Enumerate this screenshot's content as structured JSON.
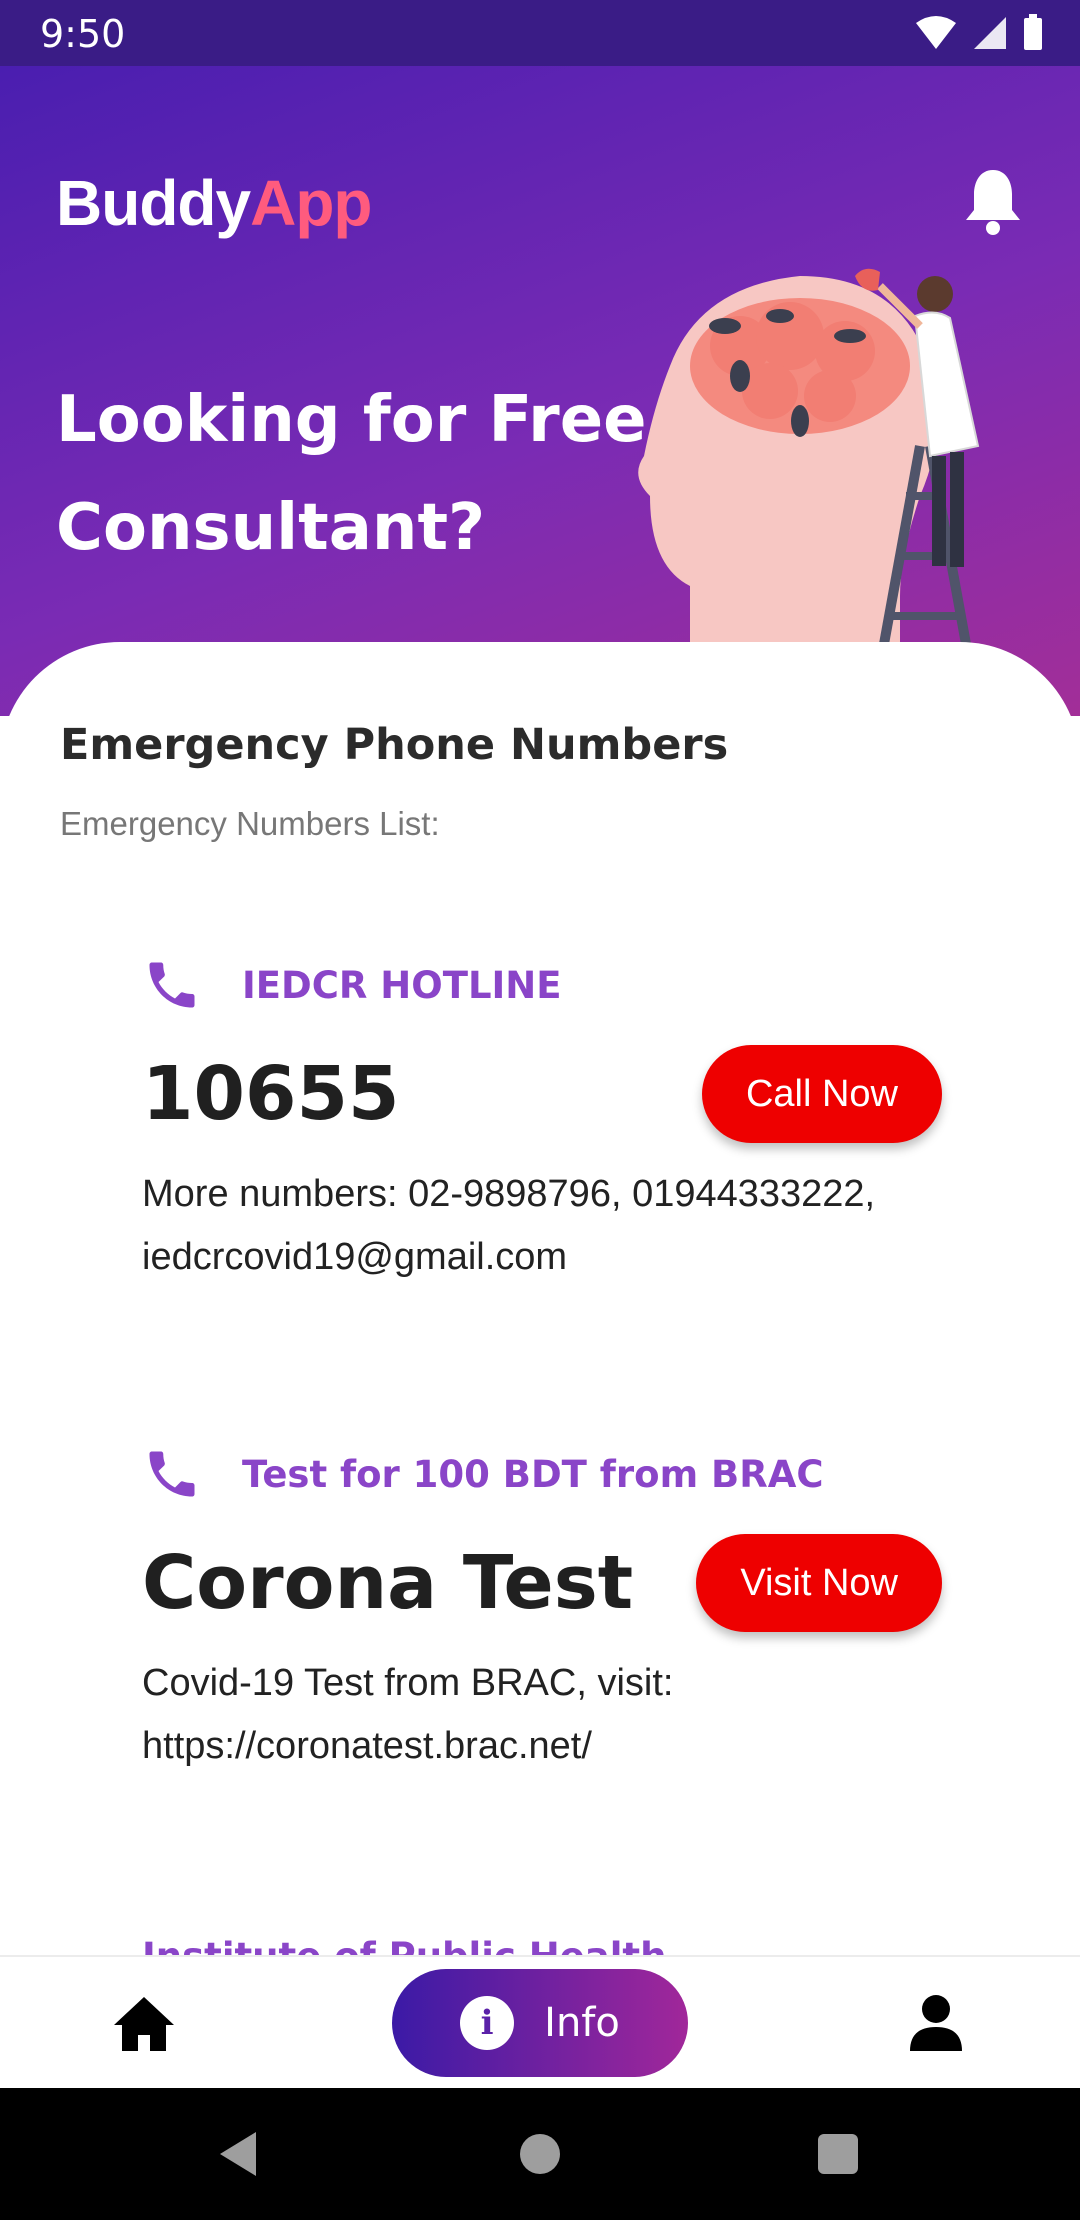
{
  "status_bar": {
    "time": "9:50"
  },
  "header": {
    "logo_part1": "Buddy",
    "logo_part2": "App",
    "title_line1": "Looking for Free",
    "title_line2": "Consultant?"
  },
  "section": {
    "title": "Emergency Phone Numbers",
    "subtitle": "Emergency Numbers List:"
  },
  "cards": [
    {
      "tag": "IEDCR HOTLINE",
      "main": "10655",
      "button": "Call Now",
      "desc": "More numbers: 02-9898796, 01944333222, iedcrcovid19@gmail.com"
    },
    {
      "tag": "Test for 100 BDT from BRAC",
      "main": "Corona Test",
      "button": "Visit Now",
      "desc": "Covid-19 Test from BRAC, visit: https://coronatest.brac.net/"
    }
  ],
  "partial_card_tag": "Institute of Public Health",
  "bottom_nav": {
    "info_label": "Info",
    "info_icon_letter": "i"
  },
  "colors": {
    "accent_purple": "#8a45c8",
    "button_red": "#ee0000",
    "logo_pink": "#ff5b7e"
  }
}
